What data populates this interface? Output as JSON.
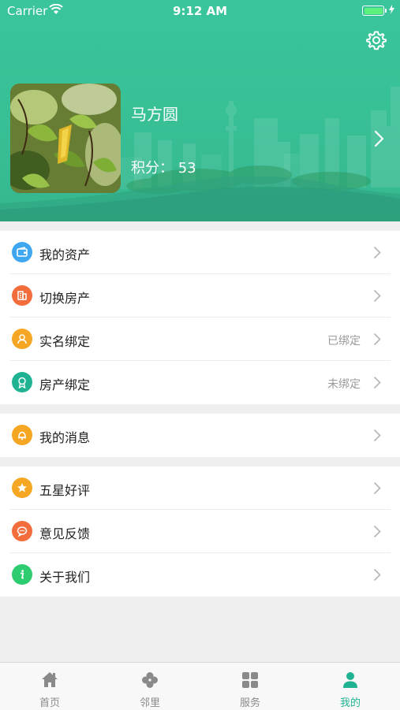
{
  "status_bar": {
    "carrier": "Carrier",
    "time": "9:12 AM"
  },
  "profile": {
    "name": "马方圆",
    "points": "积分：  53"
  },
  "groups": [
    {
      "items": [
        {
          "label": "我的资产",
          "status": "",
          "icon": "wallet-icon",
          "color": "#3fa7f0"
        },
        {
          "label": "切换房产",
          "status": "",
          "icon": "building-icon",
          "color": "#f26c3c"
        },
        {
          "label": "实名绑定",
          "status": "已绑定",
          "icon": "user-verify-icon",
          "color": "#f5a623"
        },
        {
          "label": "房产绑定",
          "status": "未绑定",
          "icon": "badge-icon",
          "color": "#1fb394"
        }
      ]
    },
    {
      "items": [
        {
          "label": "我的消息",
          "status": "",
          "icon": "bell-icon",
          "color": "#f5a623"
        }
      ]
    },
    {
      "items": [
        {
          "label": "五星好评",
          "status": "",
          "icon": "star-icon",
          "color": "#f5a623"
        },
        {
          "label": "意见反馈",
          "status": "",
          "icon": "chat-icon",
          "color": "#f26c3c"
        },
        {
          "label": "关于我们",
          "status": "",
          "icon": "info-icon",
          "color": "#2ecc71"
        }
      ]
    }
  ],
  "tabs": [
    {
      "label": "首页",
      "icon": "home-icon",
      "active": false
    },
    {
      "label": "邻里",
      "icon": "clover-icon",
      "active": false
    },
    {
      "label": "服务",
      "icon": "grid-icon",
      "active": false
    },
    {
      "label": "我的",
      "icon": "person-icon",
      "active": true
    }
  ],
  "colors": {
    "header": "#3ac59c",
    "accent": "#1fb394",
    "tab_inactive": "#8a8a8a"
  }
}
